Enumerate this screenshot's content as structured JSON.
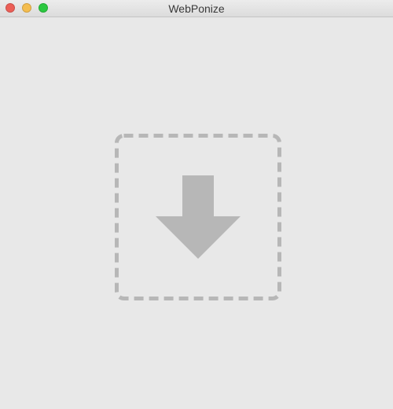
{
  "window": {
    "title": "WebPonize",
    "controls": {
      "close_color": "#ec5f57",
      "minimize_color": "#f4bd4f",
      "zoom_color": "#2bc840"
    }
  },
  "drop_zone": {
    "icon": "download-arrow-icon",
    "border_color": "#b7b7b7",
    "arrow_color": "#b7b7b7"
  }
}
